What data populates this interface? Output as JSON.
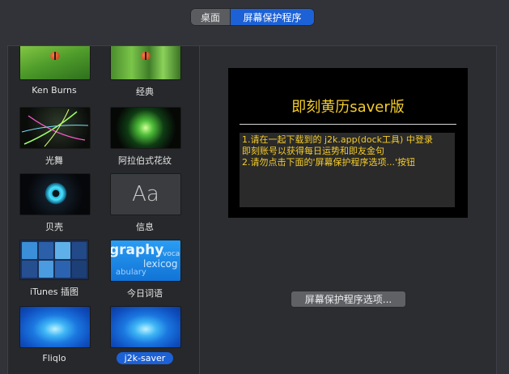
{
  "tabs": {
    "desktop": "桌面",
    "screensaver": "屏幕保护程序"
  },
  "savers": [
    {
      "label": "Ken Burns",
      "thumb": "ladybug-leaf"
    },
    {
      "label": "经典",
      "thumb": "ladybug-grass"
    },
    {
      "label": "光舞",
      "thumb": "light-streaks"
    },
    {
      "label": "阿拉伯式花纹",
      "thumb": "arabesque-burst"
    },
    {
      "label": "贝壳",
      "thumb": "shell-flower"
    },
    {
      "label": "信息",
      "thumb": "message-aa"
    },
    {
      "label": "iTunes 插图",
      "thumb": "album-grid"
    },
    {
      "label": "今日词语",
      "thumb": "word-of-the-day"
    },
    {
      "label": "Fliqlo",
      "thumb": "blue-swirl"
    },
    {
      "label": "j2k-saver",
      "thumb": "blue-swirl",
      "selected": true
    }
  ],
  "thumb_text": {
    "message": "Aa",
    "word_1": "graphy",
    "word_2": "lexicog",
    "word_3": "abulary",
    "word_4": "voca"
  },
  "preview": {
    "title": "即刻黄历saver版",
    "lines": [
      "1.请在一起下载到的 j2k.app(dock工具) 中登录",
      "即刻账号以获得每日运势和即友金句",
      "2.请勿点击下面的'屏幕保护程序选项...'按钮"
    ]
  },
  "options_button": "屏幕保护程序选项...",
  "colors": {
    "accent": "#1c61d6",
    "preview_text": "#f5cc2a"
  }
}
